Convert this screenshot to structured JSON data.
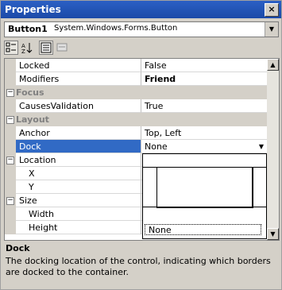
{
  "window": {
    "title": "Properties",
    "close_glyph": "×"
  },
  "object_selector": {
    "name": "Button1",
    "type": "System.Windows.Forms.Button"
  },
  "toolbar": {
    "buttons": [
      "categorized-icon",
      "alphabetical-icon",
      "properties-icon",
      "events-icon"
    ]
  },
  "grid": {
    "rows": [
      {
        "kind": "prop",
        "name": "Locked",
        "value": "False"
      },
      {
        "kind": "prop",
        "name": "Modifiers",
        "value": "Friend",
        "bold": true
      },
      {
        "kind": "cat",
        "name": "Focus"
      },
      {
        "kind": "prop",
        "name": "CausesValidation",
        "value": "True"
      },
      {
        "kind": "cat",
        "name": "Layout"
      },
      {
        "kind": "prop",
        "name": "Anchor",
        "value": "Top, Left"
      },
      {
        "kind": "prop",
        "name": "Dock",
        "value": "None",
        "selected": true
      },
      {
        "kind": "group",
        "name": "Location"
      },
      {
        "kind": "sub",
        "name": "X"
      },
      {
        "kind": "sub",
        "name": "Y"
      },
      {
        "kind": "group",
        "name": "Size"
      },
      {
        "kind": "sub",
        "name": "Width"
      },
      {
        "kind": "sub",
        "name": "Height"
      }
    ]
  },
  "dock_dropdown": {
    "none_label": "None"
  },
  "description": {
    "title": "Dock",
    "text": "The docking location of the control, indicating which borders are docked to the container."
  }
}
